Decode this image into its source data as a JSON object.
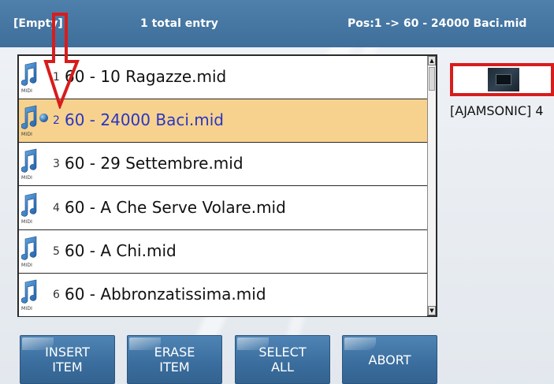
{
  "header": {
    "left_label": "[Empty]",
    "entry_count": "1 total entry",
    "position": "Pos:1 -> 60 - 24000 Baci.mid"
  },
  "file_list": {
    "icon": "midi-note-icon",
    "icon_tag": "MIDI",
    "selected_index": 1,
    "items": [
      {
        "num": "1",
        "name": "60 - 10 Ragazze.mid"
      },
      {
        "num": "2",
        "name": "60 - 24000 Baci.mid"
      },
      {
        "num": "3",
        "name": "60 - 29 Settembre.mid"
      },
      {
        "num": "4",
        "name": "60 - A Che Serve Volare.mid"
      },
      {
        "num": "5",
        "name": "60 - A Chi.mid"
      },
      {
        "num": "6",
        "name": "60 - Abbronzatissima.mid"
      }
    ]
  },
  "preview": {
    "label": "[AJAMSONIC] 4"
  },
  "buttons": {
    "insert": "INSERT\nITEM",
    "erase": "ERASE\nITEM",
    "select_all": "SELECT\nALL",
    "abort": "ABORT"
  },
  "colors": {
    "header": "#4a7aa6",
    "selected_row": "#f6d28e",
    "selected_text": "#2a35c4",
    "annotation": "#d81c1c",
    "button": "#3f73a3"
  }
}
